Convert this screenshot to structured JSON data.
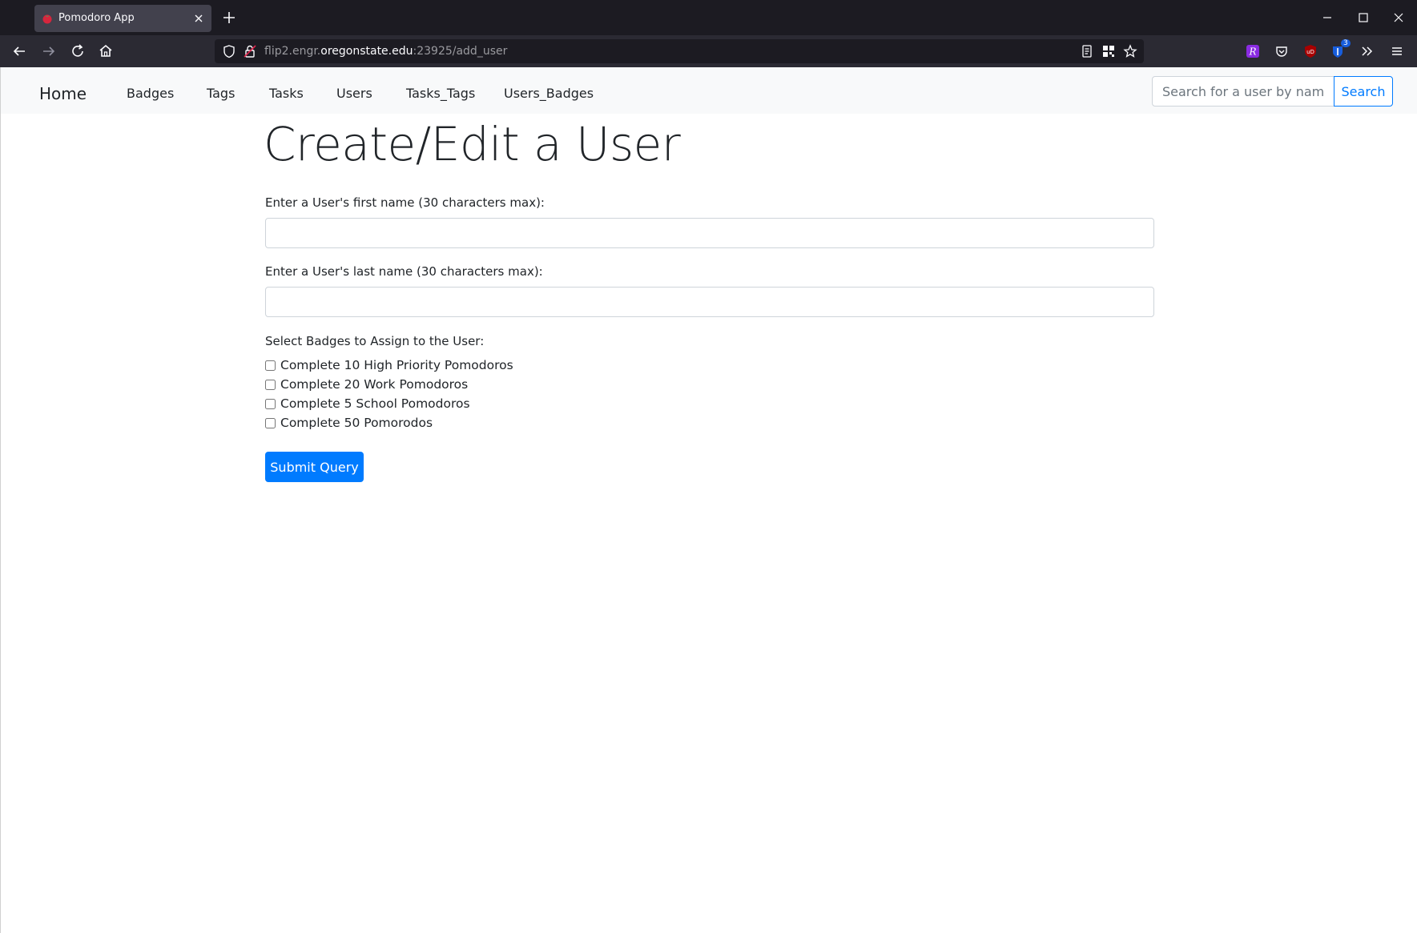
{
  "browser": {
    "tab_title": "Pomodoro App",
    "url_prefix": "flip2.engr.",
    "url_host": "oregonstate.edu",
    "url_suffix": ":23925/add_user",
    "extension_badge_count": "3"
  },
  "nav": {
    "brand": "Home",
    "links": [
      "Badges",
      "Tags",
      "Tasks",
      "Users",
      "Tasks_Tags",
      "Users_Badges"
    ],
    "search_placeholder": "Search for a user by name...",
    "search_button": "Search"
  },
  "form": {
    "title": "Create/Edit a User",
    "first_name_label": "Enter a User's first name (30 characters max):",
    "first_name_value": "",
    "last_name_label": "Enter a User's last name (30 characters max):",
    "last_name_value": "",
    "badges_label": "Select Badges to Assign to the User:",
    "badges": [
      {
        "label": "Complete 10 High Priority Pomodoros",
        "checked": false
      },
      {
        "label": "Complete 20 Work Pomodoros",
        "checked": false
      },
      {
        "label": "Complete 5 School Pomodoros",
        "checked": false
      },
      {
        "label": "Complete 50 Pomorodos",
        "checked": false
      }
    ],
    "submit_label": "Submit Query"
  },
  "colors": {
    "primary": "#007bff",
    "navbar_bg": "#f8f9fa",
    "chrome_dark": "#1c1b22",
    "chrome_toolbar": "#2b2a33"
  }
}
